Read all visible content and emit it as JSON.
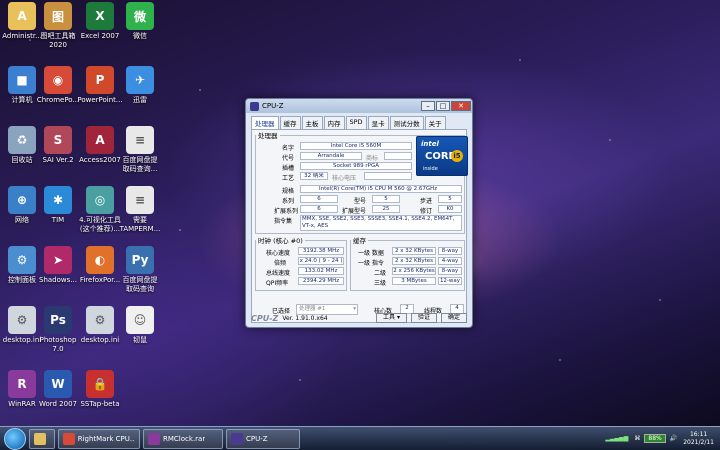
{
  "desktop": {
    "icons": [
      {
        "label": "Administr...",
        "name": "administrator-folder-icon",
        "color": "#e8c15a",
        "glyph": "A"
      },
      {
        "label": "图吧工具箱\n2020",
        "name": "tool-box-icon",
        "color": "#c99040",
        "glyph": "图"
      },
      {
        "label": "Excel 2007",
        "name": "excel-icon",
        "color": "#1d7a3a",
        "glyph": "X"
      },
      {
        "label": "微信",
        "name": "wechat-icon",
        "color": "#2fb24c",
        "glyph": "微"
      },
      {
        "label": "计算机",
        "name": "computer-icon",
        "color": "#3a7fd0",
        "glyph": "■"
      },
      {
        "label": "ChromePo...",
        "name": "chrome-icon",
        "color": "#d84a38",
        "glyph": "◉"
      },
      {
        "label": "PowerPoint...",
        "name": "powerpoint-icon",
        "color": "#d0492b",
        "glyph": "P"
      },
      {
        "label": "迅雷",
        "name": "thunder-icon",
        "color": "#3c8fe0",
        "glyph": "✈"
      },
      {
        "label": "回收站",
        "name": "recycle-bin-icon",
        "color": "#8aa4c0",
        "glyph": "♻"
      },
      {
        "label": "SAI Ver.2",
        "name": "sai-icon",
        "color": "#b0485a",
        "glyph": "S"
      },
      {
        "label": "Access2007",
        "name": "access-icon",
        "color": "#a0243a",
        "glyph": "A"
      },
      {
        "label": "百度网盘提\n取码查询...",
        "name": "baidu-doc-icon",
        "color": "#e8e8e8",
        "glyph": "≡"
      },
      {
        "label": "网络",
        "name": "network-icon",
        "color": "#3a80c8",
        "glyph": "⊕"
      },
      {
        "label": "TIM",
        "name": "tim-icon",
        "color": "#2a8ad8",
        "glyph": "✱"
      },
      {
        "label": "4.可视化工具\n(这个推荐)...",
        "name": "visual-tool-icon",
        "color": "#4aa0a0",
        "glyph": "◎"
      },
      {
        "label": "需要\nTAMPERM...",
        "name": "tampermonkey-doc-icon",
        "color": "#e8e8e8",
        "glyph": "≡"
      },
      {
        "label": "控制面板",
        "name": "control-panel-icon",
        "color": "#4a8ed0",
        "glyph": "⚙"
      },
      {
        "label": "Shadows...",
        "name": "shadowsocks-icon",
        "color": "#b02a6a",
        "glyph": "➤"
      },
      {
        "label": "FirefoxPor...",
        "name": "firefox-icon",
        "color": "#e0702a",
        "glyph": "◐"
      },
      {
        "label": "百度网盘提\n取码查询",
        "name": "python-script-icon",
        "color": "#3a70b0",
        "glyph": "Py"
      },
      {
        "label": "desktop.ini",
        "name": "desktop-ini-icon",
        "color": "#cfd6de",
        "glyph": "⚙"
      },
      {
        "label": "Photoshop\n7.0",
        "name": "photoshop-icon",
        "color": "#2a3a70",
        "glyph": "Ps"
      },
      {
        "label": "desktop.ini",
        "name": "desktop-ini-icon-2",
        "color": "#cfd6de",
        "glyph": "⚙"
      },
      {
        "label": "韧鼠",
        "name": "mouse-app-icon",
        "color": "#f0f0f0",
        "glyph": "☺"
      },
      {
        "label": "WinRAR",
        "name": "winrar-icon",
        "color": "#8a3a9a",
        "glyph": "R"
      },
      {
        "label": "Word 2007",
        "name": "word-icon",
        "color": "#2a5ab0",
        "glyph": "W"
      },
      {
        "label": "SSTap-beta",
        "name": "sstap-icon",
        "color": "#c83030",
        "glyph": "🔒"
      }
    ]
  },
  "cpuz": {
    "title": "CPU-Z",
    "tabs": [
      "处理器",
      "缓存",
      "主板",
      "内存",
      "SPD",
      "显卡",
      "测试分数",
      "关于"
    ],
    "processor_legend": "处理器",
    "name_label": "名字",
    "name_value": "Intel Core i5 560M",
    "codename_label": "代号",
    "codename_value": "Arrandale",
    "brand_id_label": "商标",
    "socket_label": "插槽",
    "socket_value": "Socket 989 rPGA",
    "tech_label": "工艺",
    "tech_value": "32 纳米",
    "vcore_label": "核心电压",
    "spec_label": "规格",
    "spec_value": "Intel(R) Core(TM) i5 CPU      M 560  @ 2.67GHz",
    "family_label": "系列",
    "family_value": "6",
    "model_label": "型号",
    "model_value": "5",
    "stepping_label": "步进",
    "stepping_value": "5",
    "extfamily_label": "扩展系列",
    "extfamily_value": "6",
    "extmodel_label": "扩展型号",
    "extmodel_value": "25",
    "revision_label": "修订",
    "revision_value": "K0",
    "instr_label": "指令集",
    "instr_value": "MMX, SSE, SSE2, SSE3, SSSE3, SSE4.1, SSE4.2, EM64T, VT-x, AES",
    "intel_logo": {
      "brand": "intel",
      "line": "CORE",
      "badge": "i5",
      "tag": "inside"
    },
    "clocks_legend": "时钟 (核心 #0)",
    "core_speed_label": "核心速度",
    "core_speed_value": "3192.38 MHz",
    "multiplier_label": "倍频",
    "multiplier_value": "x 24.0 ( 9 - 24 )",
    "bus_speed_label": "总线速度",
    "bus_speed_value": "133.02 MHz",
    "qpi_label": "QPI频率",
    "qpi_value": "2394.29 MHz",
    "cache_legend": "缓存",
    "l1d_label": "一级 数据",
    "l1d_value": "2 x 32 KBytes",
    "l1d_way": "8-way",
    "l1i_label": "一级 指令",
    "l1i_value": "2 x 32 KBytes",
    "l1i_way": "4-way",
    "l2_label": "二级",
    "l2_value": "2 x 256 KBytes",
    "l2_way": "8-way",
    "l3_label": "三级",
    "l3_value": "3 MBytes",
    "l3_way": "12-way",
    "selection_label": "已选择",
    "selection_value": "处理器 #1",
    "cores_label": "核心数",
    "cores_value": "2",
    "threads_label": "线程数",
    "threads_value": "4",
    "footer_logo": "CPU-Z",
    "version": "Ver. 1.91.0.x64",
    "tools_label": "工具",
    "validate_label": "验证",
    "ok_label": "确定"
  },
  "taskbar": {
    "items": [
      {
        "label": "",
        "name": "taskbar-explorer",
        "color": "#e0c060"
      },
      {
        "label": "RightMark CPU...",
        "name": "taskbar-rightmark",
        "color": "#d84a38"
      },
      {
        "label": "RMClock.rar",
        "name": "taskbar-rmclock",
        "color": "#8a3a9a"
      },
      {
        "label": "CPU-Z",
        "name": "taskbar-cpuz",
        "color": "#4a3a90"
      }
    ],
    "battery": "88%",
    "time": "16:11",
    "date": "2021/2/11"
  }
}
